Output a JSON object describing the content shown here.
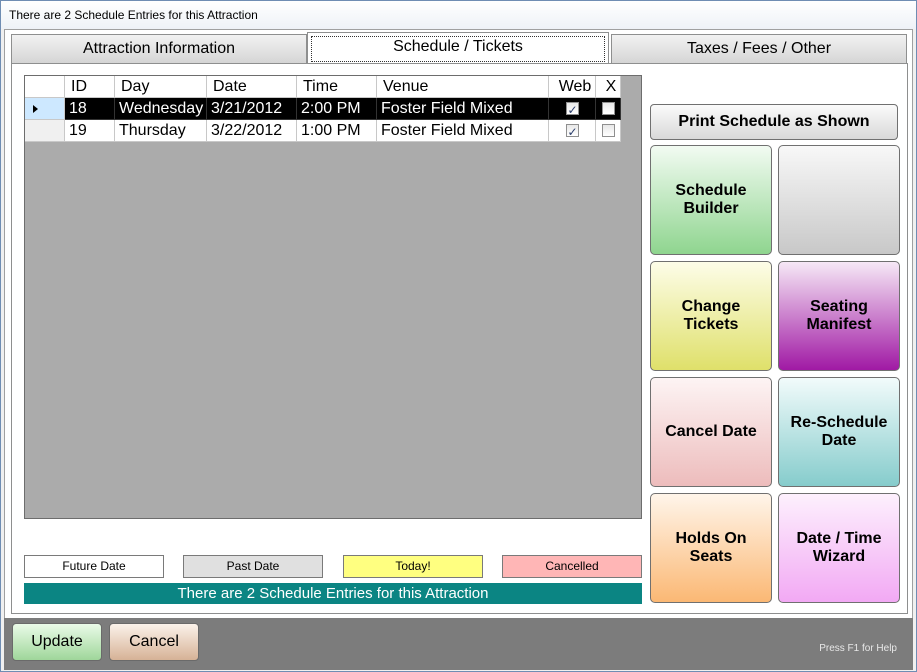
{
  "window": {
    "title": "There are 2 Schedule Entries for this Attraction"
  },
  "tabs": [
    {
      "label": "Attraction Information"
    },
    {
      "label": "Schedule / Tickets"
    },
    {
      "label": "Taxes / Fees / Other"
    }
  ],
  "grid": {
    "columns": [
      "ID",
      "Day",
      "Date",
      "Time",
      "Venue",
      "Web",
      "X"
    ],
    "rows": [
      {
        "id": "18",
        "day": "Wednesday",
        "date": "3/21/2012",
        "time": "2:00 PM",
        "venue": "Foster Field Mixed",
        "web": true,
        "x": false
      },
      {
        "id": "19",
        "day": "Thursday",
        "date": "3/22/2012",
        "time": "1:00 PM",
        "venue": "Foster Field Mixed",
        "web": true,
        "x": false
      }
    ]
  },
  "legend": {
    "future": "Future Date",
    "past": "Past Date",
    "today": "Today!",
    "cancelled": "Cancelled"
  },
  "status": "There are 2 Schedule Entries for this Attraction",
  "buttons": {
    "print": "Print Schedule as Shown",
    "schedule_builder": "Schedule Builder",
    "blank": "",
    "change_tickets": "Change Tickets",
    "seating_manifest": "Seating Manifest",
    "cancel_date": "Cancel Date",
    "reschedule_date": "Re-Schedule Date",
    "holds_on_seats": "Holds On Seats",
    "date_time_wizard": "Date / Time Wizard",
    "update": "Update",
    "cancel": "Cancel"
  },
  "help": "Press F1 for Help",
  "colors": {
    "status_bg": "#0b8583",
    "selected_row": "#000000",
    "today": "#ffff80",
    "cancelled": "#ffb6b6",
    "past": "#e0e0e0"
  }
}
